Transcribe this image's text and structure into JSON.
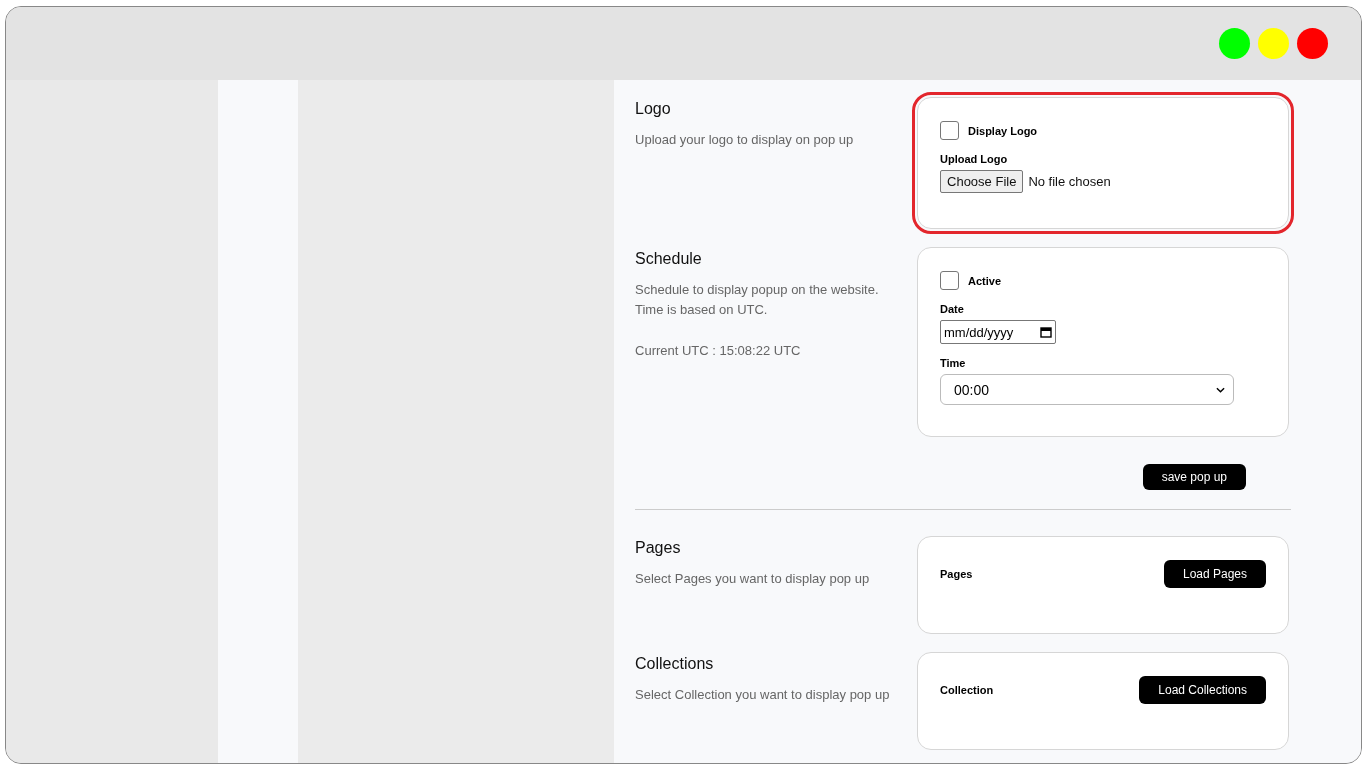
{
  "window": {
    "controls": [
      {
        "color": "#00ff00"
      },
      {
        "color": "#ffff00"
      },
      {
        "color": "#ff0000"
      }
    ]
  },
  "sections": [
    {
      "kind": "logo",
      "title": "Logo",
      "description": [
        "Upload your logo to display on pop up"
      ],
      "highlighted": true,
      "checkbox": {
        "label": "Display Logo",
        "checked": false
      },
      "upload": {
        "label": "Upload Logo",
        "button": "Choose File",
        "status": "No file chosen"
      }
    },
    {
      "kind": "schedule",
      "title": "Schedule",
      "description": [
        "Schedule to display popup on the website.",
        "Time is based on UTC."
      ],
      "current_time": "Current UTC : 15:08:22 UTC",
      "highlighted": false,
      "checkbox": {
        "label": "Active",
        "checked": false
      },
      "date": {
        "label": "Date",
        "placeholder": "mm/dd/yyyy"
      },
      "time": {
        "label": "Time",
        "value": "00:00"
      },
      "save_button": "save pop up"
    },
    {
      "kind": "loader",
      "title": "Pages",
      "description": [
        "Select Pages you want to display pop up"
      ],
      "highlighted": false,
      "card_label": "Pages",
      "button": "Load Pages"
    },
    {
      "kind": "loader",
      "title": "Collections",
      "description": [
        "Select Collection you want to display pop up"
      ],
      "highlighted": false,
      "card_label": "Collection",
      "button": "Load Collections"
    }
  ]
}
